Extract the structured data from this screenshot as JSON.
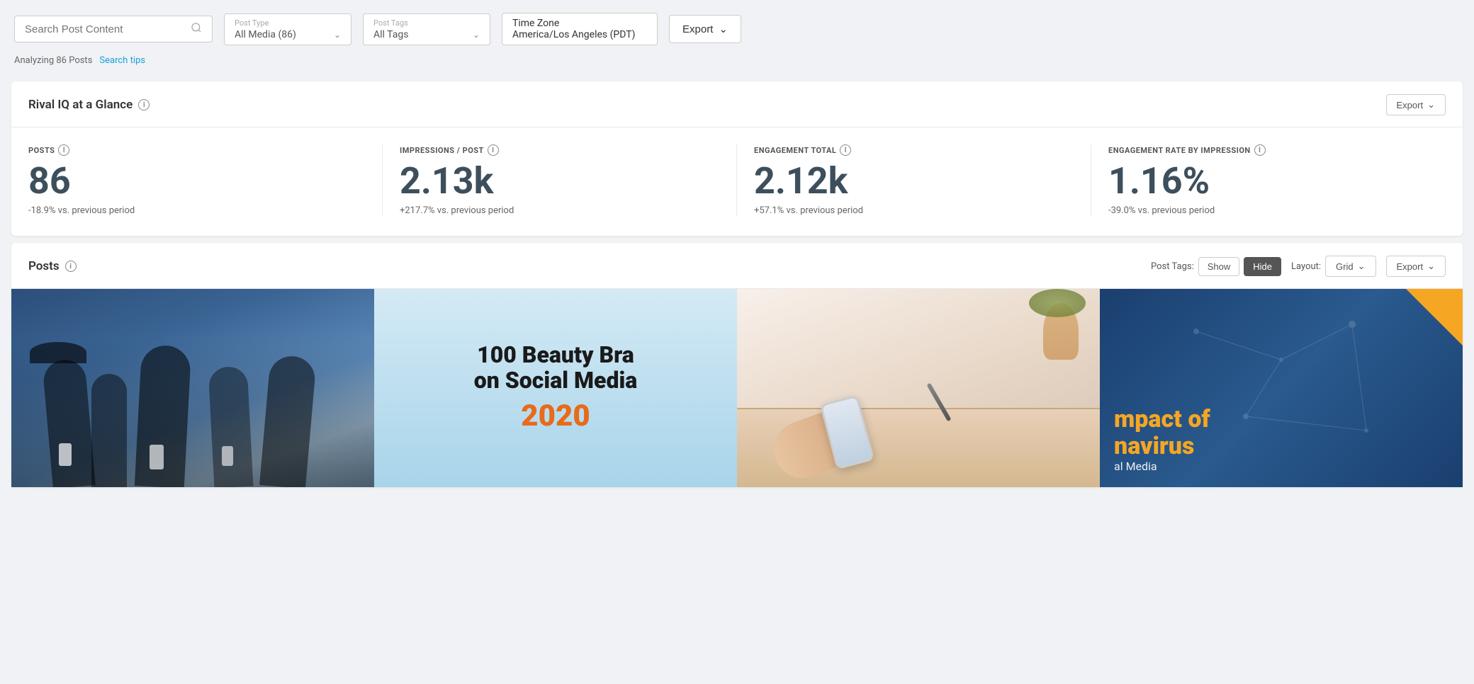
{
  "topbar": {
    "search": {
      "placeholder": "Search Post Content"
    },
    "postType": {
      "label": "Post Type",
      "value": "All Media (86)"
    },
    "postTags": {
      "label": "Post Tags",
      "value": "All Tags"
    },
    "timezone": {
      "label": "Time Zone",
      "value": "America/Los Angeles (PDT)"
    },
    "export_label": "Export"
  },
  "subbar": {
    "analyzing": "Analyzing 86 Posts",
    "search_tips": "Search tips"
  },
  "glance": {
    "title": "Rival IQ at a Glance",
    "export_label": "Export",
    "stats": [
      {
        "label": "POSTS",
        "value": "86",
        "change": "-18.9% vs. previous period"
      },
      {
        "label": "IMPRESSIONS / POST",
        "value": "2.13k",
        "change": "+217.7% vs. previous period"
      },
      {
        "label": "ENGAGEMENT TOTAL",
        "value": "2.12k",
        "change": "+57.1% vs. previous period"
      },
      {
        "label": "ENGAGEMENT RATE BY IMPRESSION",
        "value": "1.16%",
        "change": "-39.0% vs. previous period"
      }
    ]
  },
  "posts": {
    "title": "Posts",
    "post_tags_label": "Post Tags:",
    "show_label": "Show",
    "hide_label": "Hide",
    "layout_label": "Layout:",
    "grid_label": "Grid",
    "export_label": "Export",
    "cards": [
      {
        "type": "people-phones",
        "alt": "People using phones"
      },
      {
        "type": "beauty-brands",
        "line1": "100 Beauty Bra",
        "line2": "on Social Media",
        "year": "2020"
      },
      {
        "type": "phone-hand",
        "alt": "Hand holding phone"
      },
      {
        "type": "impact",
        "line1": "mpact of",
        "line2": "navirus",
        "line3": "al Media"
      }
    ]
  }
}
